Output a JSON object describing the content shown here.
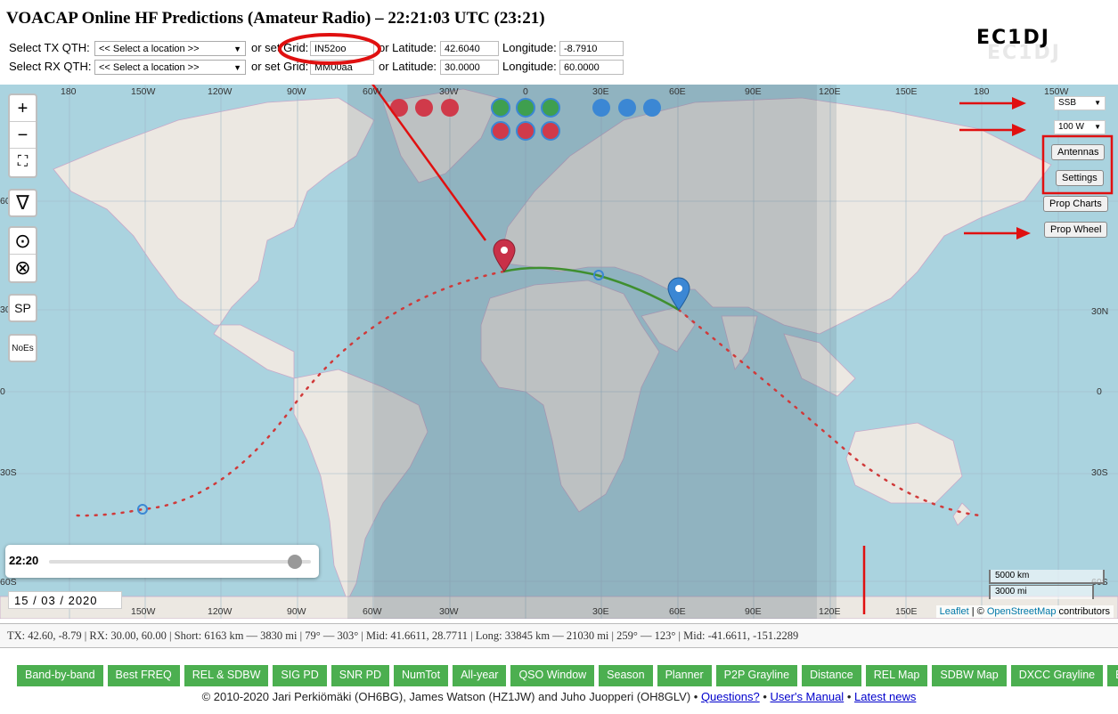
{
  "title": "VOACAP Online HF Predictions (Amateur Radio) – 22:21:03 UTC (23:21)",
  "callsign": "EC1DJ",
  "tx": {
    "label": "Select TX QTH:",
    "location_select": "<< Select a location >>",
    "grid_label": "or set Grid:",
    "grid_value": "IN52oo",
    "lat_label": "or Latitude:",
    "lat_value": "42.6040",
    "lon_label": "Longitude:",
    "lon_value": "-8.7910"
  },
  "rx": {
    "label": "Select RX QTH:",
    "location_select": "<< Select a location >>",
    "grid_label": "or set Grid:",
    "grid_value": "MM00aa",
    "lat_label": "or Latitude:",
    "lat_value": "30.0000",
    "lon_label": "Longitude:",
    "lon_value": "60.0000"
  },
  "map": {
    "lon_labels": [
      "180",
      "150W",
      "120W",
      "90W",
      "60W",
      "30W",
      "0",
      "30E",
      "60E",
      "90E",
      "120E",
      "150E",
      "180",
      "150W"
    ],
    "lat_labels_left": [
      "60",
      "30",
      "0",
      "30S",
      "60S"
    ],
    "lat_labels_right": [
      "30N",
      "0",
      "30S",
      "60S"
    ],
    "zoom_in": "+",
    "zoom_out": "−",
    "fullscreen": "⛶",
    "path_btn": "∇",
    "target_btn": "⊙",
    "cancel_btn": "⊗",
    "sp_btn": "SP",
    "noes_btn": "NoEs",
    "mode": "SSB",
    "power": "100 W",
    "antennas_btn": "Antennas",
    "settings_btn": "Settings",
    "prop_charts_btn": "Prop Charts",
    "prop_wheel_btn": "Prop Wheel",
    "time_label": "22:20",
    "time_fraction": 0.94,
    "date_value": "15 / 03 / 2020",
    "scale_km": "5000 km",
    "scale_mi": "3000 mi",
    "attribution_leaflet": "Leaflet",
    "attribution_sep": " | © ",
    "attribution_osm": "OpenStreetMap",
    "attribution_tail": " contributors"
  },
  "status": "TX: 42.60, -8.79 | RX: 30.00, 60.00 | Short: 6163 km — 3830 mi | 79° — 303° | Mid: 41.6611, 28.7711 | Long: 33845 km — 21030 mi | 259° — 123° | Mid: -41.6611, -151.2289",
  "tabs": [
    "Band-by-band",
    "Best FREQ",
    "REL & SDBW",
    "SIG PD",
    "SNR PD",
    "NumTot",
    "All-year",
    "QSO Window",
    "Season",
    "Planner",
    "P2P Grayline",
    "Distance",
    "REL Map",
    "SDBW Map",
    "DXCC Grayline",
    "EME"
  ],
  "footer": {
    "copyright": "© 2010-2020 Jari Perkiömäki (OH6BG), James Watson (HZ1JW) and Juho Juopperi (OH8GLV) •",
    "questions": "Questions?",
    "sep": "•",
    "manual": "User's Manual",
    "news": "Latest news"
  },
  "colors": {
    "ocean": "#aad3df",
    "land": "#ece8e2",
    "night": "#5b6f7f",
    "short_path": "#3f8f2f",
    "long_path": "#d03a3a",
    "tx_marker": "#c93048",
    "rx_marker": "#3b87d4",
    "tab_green": "#4caf50",
    "annotation_red": "#e01010"
  }
}
